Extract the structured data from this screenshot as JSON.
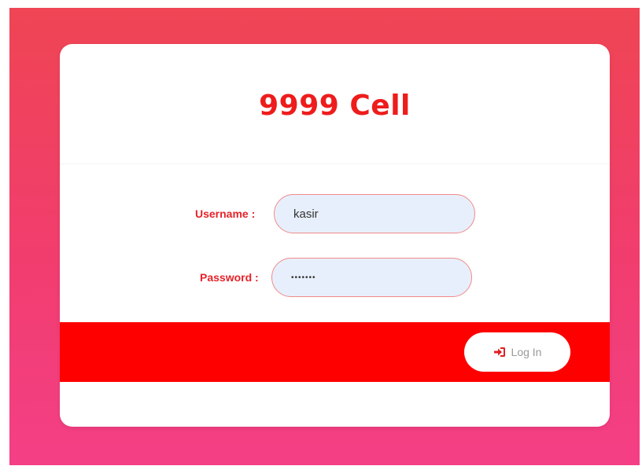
{
  "brand": {
    "title": "9999 Cell"
  },
  "form": {
    "username_label": "Username :",
    "username_value": "kasir",
    "password_label": "Password :",
    "password_value": "•••••••"
  },
  "actions": {
    "login_label": "Log In",
    "login_icon": "sign-in-icon"
  },
  "colors": {
    "accent": "#fe0000",
    "title": "#ee1c1c",
    "background_top": "#ef4554",
    "background_bottom": "#f43f86",
    "field_bg": "#e8effc"
  }
}
